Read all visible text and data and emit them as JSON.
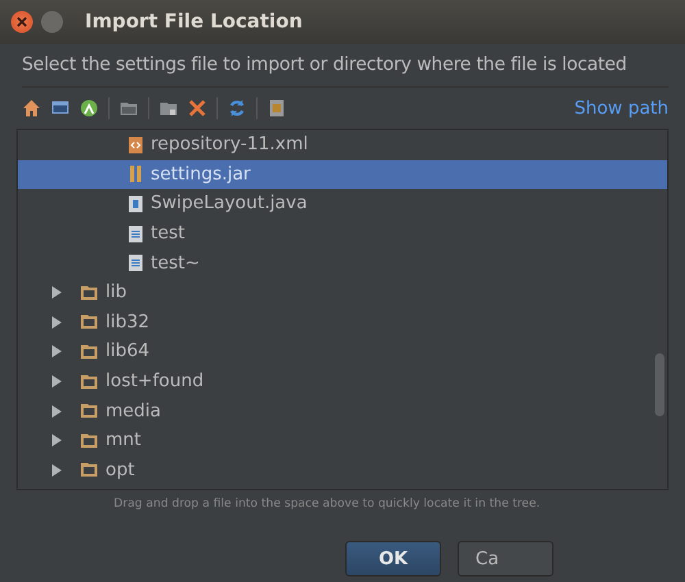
{
  "window": {
    "title": "Import File Location"
  },
  "description": "Select the settings file to import or directory where the file is located",
  "toolbar": [
    {
      "kind": "home"
    },
    {
      "kind": "desktop"
    },
    {
      "kind": "android"
    },
    {
      "kind": "folder"
    },
    {
      "kind": "new-folder"
    },
    {
      "kind": "delete"
    },
    {
      "kind": "refresh"
    },
    {
      "kind": "hidden"
    }
  ],
  "show_path": "Show path",
  "tree": {
    "branch_items": [
      {
        "label": "repository-11.xml",
        "kind": "xml",
        "selected": false
      },
      {
        "label": "settings.jar",
        "kind": "jar",
        "selected": true
      },
      {
        "label": "SwipeLayout.java",
        "kind": "java",
        "selected": false
      },
      {
        "label": "test",
        "kind": "text",
        "selected": false
      },
      {
        "label": "test~",
        "kind": "text",
        "selected": false
      }
    ],
    "items": [
      {
        "label": "lib",
        "kind": "folder",
        "expanded": false,
        "selected": false
      },
      {
        "label": "lib32",
        "kind": "folder",
        "expanded": false,
        "selected": false
      },
      {
        "label": "lib64",
        "kind": "folder",
        "expanded": false,
        "selected": false
      },
      {
        "label": "lost+found",
        "kind": "folder",
        "expanded": false,
        "selected": false
      },
      {
        "label": "media",
        "kind": "folder",
        "expanded": false,
        "selected": false
      },
      {
        "label": "mnt",
        "kind": "folder",
        "expanded": false,
        "selected": false
      },
      {
        "label": "opt",
        "kind": "folder",
        "expanded": false,
        "selected": false
      }
    ]
  },
  "hint": "Drag and drop a file into the space above to quickly locate it in the tree.",
  "buttons": [
    {
      "label": "OK",
      "kind": "default"
    },
    {
      "label": "Ca",
      "kind": "normal"
    }
  ]
}
